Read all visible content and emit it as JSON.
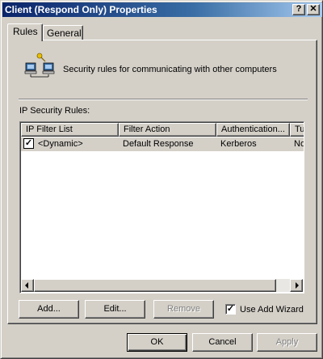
{
  "window": {
    "title": "Client (Respond Only) Properties",
    "help_label": "?",
    "close_label": "✕"
  },
  "tabs": [
    {
      "label": "Rules",
      "selected": true
    },
    {
      "label": "General",
      "selected": false
    }
  ],
  "rules_tab": {
    "description": "Security rules for communicating with other computers",
    "list_label": "IP Security Rules:",
    "columns": [
      "IP Filter List",
      "Filter Action",
      "Authentication...",
      "Tu"
    ],
    "rows": [
      {
        "checked": "✓",
        "ip_filter_list": "<Dynamic>",
        "filter_action": "Default Response",
        "authentication": "Kerberos",
        "tunnel": "No"
      }
    ],
    "buttons": {
      "add": "Add...",
      "edit": "Edit...",
      "remove": "Remove"
    },
    "use_wizard": {
      "label": "Use Add Wizard",
      "checked": "✓"
    }
  },
  "dialog_buttons": {
    "ok": "OK",
    "cancel": "Cancel",
    "apply": "Apply"
  },
  "colors": {
    "title_start": "#0a246a",
    "title_end": "#a6caf0",
    "face": "#d4d0c8"
  },
  "icons": {
    "network": "network-computers-icon"
  }
}
